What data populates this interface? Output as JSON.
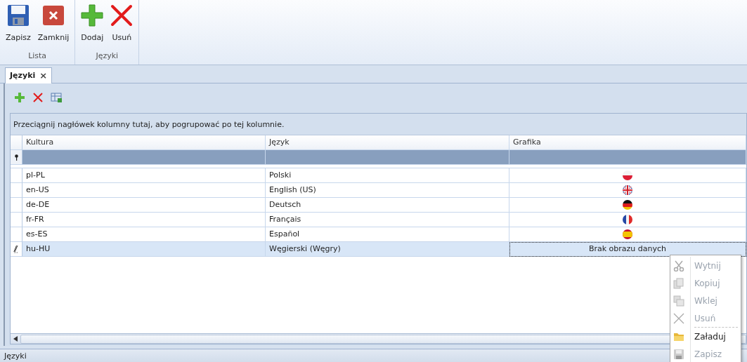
{
  "ribbon": {
    "groups": [
      {
        "label": "Lista",
        "buttons": [
          {
            "label": "Zapisz",
            "kind": "save"
          },
          {
            "label": "Zamknij",
            "kind": "close"
          }
        ]
      },
      {
        "label": "Języki",
        "buttons": [
          {
            "label": "Dodaj",
            "kind": "add"
          },
          {
            "label": "Usuń",
            "kind": "delete"
          }
        ]
      }
    ]
  },
  "tabs": [
    {
      "label": "Języki",
      "selected": true,
      "close": "×"
    }
  ],
  "toolbar": [
    {
      "kind": "add"
    },
    {
      "kind": "delete"
    },
    {
      "kind": "export"
    }
  ],
  "group_panel": "Przeciągnij nagłówek kolumny tutaj, aby pogrupować po tej kolumnie.",
  "table": {
    "columns": [
      "Kultura",
      "Język",
      "Grafika"
    ],
    "rows": [
      {
        "culture": "pl-PL",
        "language": "Polski",
        "graphic": {
          "kind": "image"
        },
        "selected": false
      },
      {
        "culture": "en-US",
        "language": "English (US)",
        "graphic": {
          "kind": "image"
        },
        "selected": false
      },
      {
        "culture": "de-DE",
        "language": "Deutsch",
        "graphic": {
          "kind": "image"
        },
        "selected": false
      },
      {
        "culture": "fr-FR",
        "language": "Français",
        "graphic": {
          "kind": "image"
        },
        "selected": false
      },
      {
        "culture": "es-ES",
        "language": "Español",
        "graphic": {
          "kind": "image"
        },
        "selected": false
      },
      {
        "culture": "hu-HU",
        "language": "Węgierski (Węgry)",
        "graphic": {
          "kind": "text",
          "text": "Brak obrazu danych"
        },
        "selected": true
      }
    ]
  },
  "context_menu": [
    {
      "label": "Wytnij",
      "disabled": true,
      "separator_before": false
    },
    {
      "label": "Kopiuj",
      "disabled": true,
      "separator_before": false
    },
    {
      "label": "Wklej",
      "disabled": true,
      "separator_before": false
    },
    {
      "label": "Usuń",
      "disabled": true,
      "separator_before": false
    },
    {
      "label": "Załaduj",
      "disabled": false,
      "separator_before": true
    },
    {
      "label": "Zapisz",
      "disabled": true,
      "separator_before": false
    }
  ],
  "status_bar": "Języki"
}
